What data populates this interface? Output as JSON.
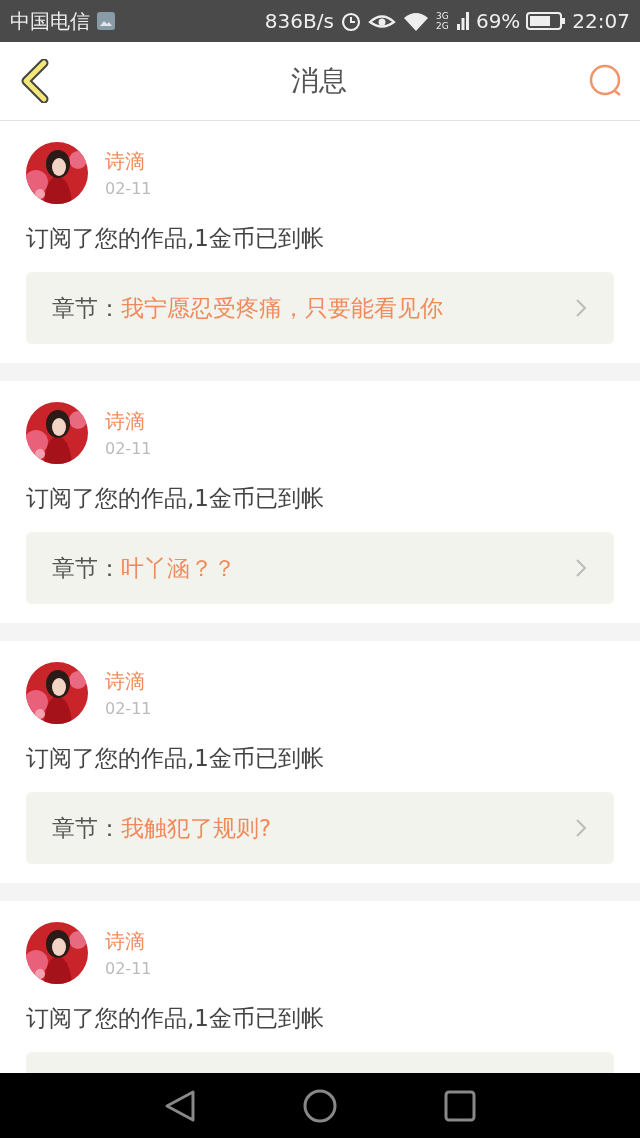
{
  "status_bar": {
    "carrier": "中国电信",
    "speed": "836B/s",
    "network": "3G 2G",
    "battery": "69%",
    "time": "22:07"
  },
  "header": {
    "title": "消息"
  },
  "messages": [
    {
      "name": "诗滴",
      "date": "02-11",
      "text": "订阅了您的作品,1金币已到帐",
      "chapter_label": "章节：",
      "chapter": "我宁愿忍受疼痛，只要能看见你"
    },
    {
      "name": "诗滴",
      "date": "02-11",
      "text": "订阅了您的作品,1金币已到帐",
      "chapter_label": "章节：",
      "chapter": "叶丫涵？？"
    },
    {
      "name": "诗滴",
      "date": "02-11",
      "text": "订阅了您的作品,1金币已到帐",
      "chapter_label": "章节：",
      "chapter": "我触犯了规则?"
    },
    {
      "name": "诗滴",
      "date": "02-11",
      "text": "订阅了您的作品,1金币已到帐"
    }
  ]
}
